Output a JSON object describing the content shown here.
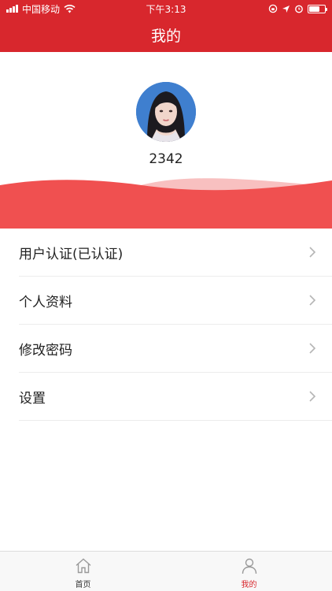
{
  "status_bar": {
    "carrier": "中国移动",
    "time": "下午3:13"
  },
  "header": {
    "title": "我的"
  },
  "profile": {
    "username": "2342"
  },
  "menu": {
    "items": [
      {
        "label": "用户认证(已认证)"
      },
      {
        "label": "个人资料"
      },
      {
        "label": "修改密码"
      },
      {
        "label": "设置"
      }
    ]
  },
  "tabbar": {
    "tabs": [
      {
        "label": "首页",
        "icon": "home-icon",
        "active": false
      },
      {
        "label": "我的",
        "icon": "person-icon",
        "active": true
      }
    ]
  },
  "colors": {
    "brand": "#d8272d",
    "wave": "#f05050",
    "wave_light": "#f8c0c0"
  }
}
